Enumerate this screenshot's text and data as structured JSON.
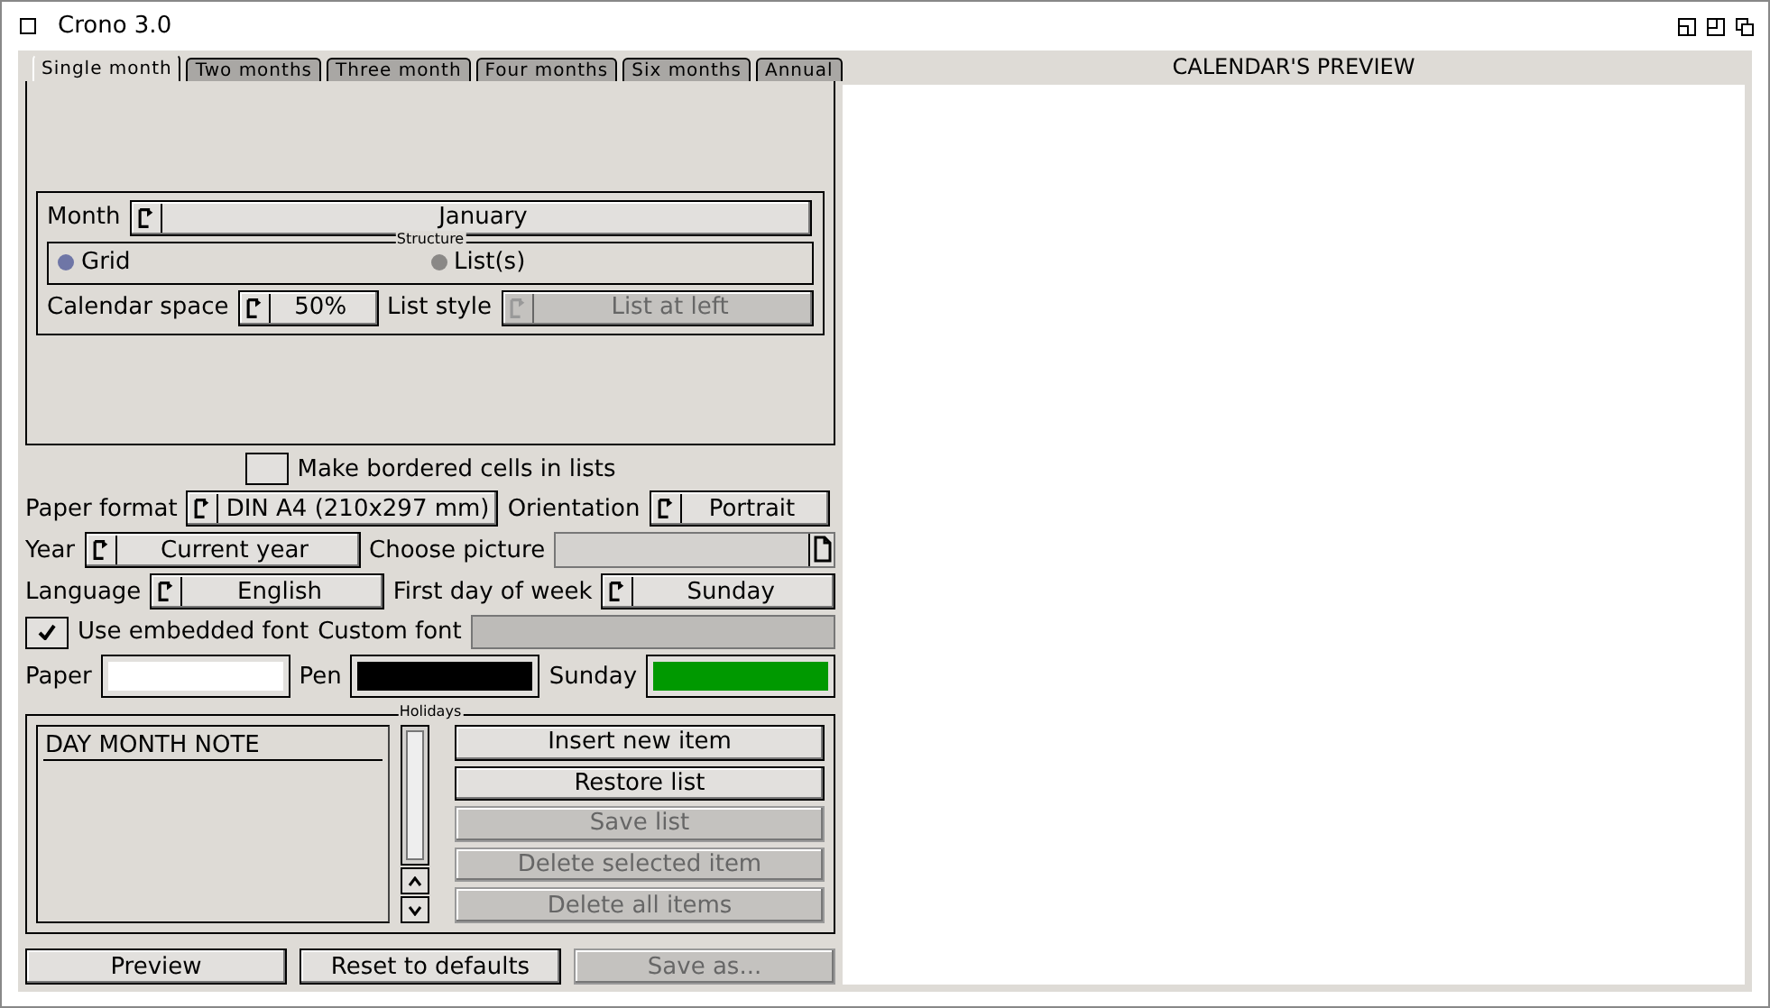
{
  "window": {
    "title": "Crono 3.0"
  },
  "tabs": [
    {
      "label": "Single month",
      "selected": true
    },
    {
      "label": "Two months",
      "selected": false
    },
    {
      "label": "Three month",
      "selected": false
    },
    {
      "label": "Four months",
      "selected": false
    },
    {
      "label": "Six months",
      "selected": false
    },
    {
      "label": "Annual",
      "selected": false
    }
  ],
  "single_month": {
    "month": {
      "label": "Month",
      "value": "January"
    },
    "structure": {
      "title": "Structure",
      "options": [
        {
          "label": "Grid",
          "selected": true
        },
        {
          "label": "List(s)",
          "selected": false
        }
      ]
    },
    "calendar_space": {
      "label": "Calendar space",
      "value": "50%"
    },
    "list_style": {
      "label": "List style",
      "value": "List at left",
      "disabled": true
    }
  },
  "bordered_cells": {
    "label": "Make bordered cells in lists",
    "checked": false
  },
  "paper_format": {
    "label": "Paper format",
    "value": "DIN A4 (210x297 mm)"
  },
  "orientation": {
    "label": "Orientation",
    "value": "Portrait"
  },
  "year": {
    "label": "Year",
    "value": "Current year"
  },
  "choose_picture": {
    "label": "Choose picture"
  },
  "language": {
    "label": "Language",
    "value": "English"
  },
  "first_day": {
    "label": "First day of week",
    "value": "Sunday"
  },
  "embedded_font": {
    "label": "Use embedded font",
    "checked": true
  },
  "custom_font": {
    "label": "Custom font",
    "disabled": true
  },
  "colors": [
    {
      "label": "Paper",
      "color": "#ffffff"
    },
    {
      "label": "Pen",
      "color": "#000000"
    },
    {
      "label": "Sunday",
      "color": "#009900"
    }
  ],
  "holidays": {
    "title": "Holidays",
    "header": "DAY MONTH NOTE",
    "buttons": [
      {
        "label": "Insert new item",
        "disabled": false
      },
      {
        "label": "Restore list",
        "disabled": false
      },
      {
        "label": "Save list",
        "disabled": true
      },
      {
        "label": "Delete selected item",
        "disabled": true
      },
      {
        "label": "Delete all items",
        "disabled": true
      }
    ]
  },
  "bottom_buttons": [
    {
      "label": "Preview",
      "disabled": false
    },
    {
      "label": "Reset to defaults",
      "disabled": false
    },
    {
      "label": "Save as...",
      "disabled": true
    }
  ],
  "preview": {
    "title": "CALENDAR'S PREVIEW"
  }
}
